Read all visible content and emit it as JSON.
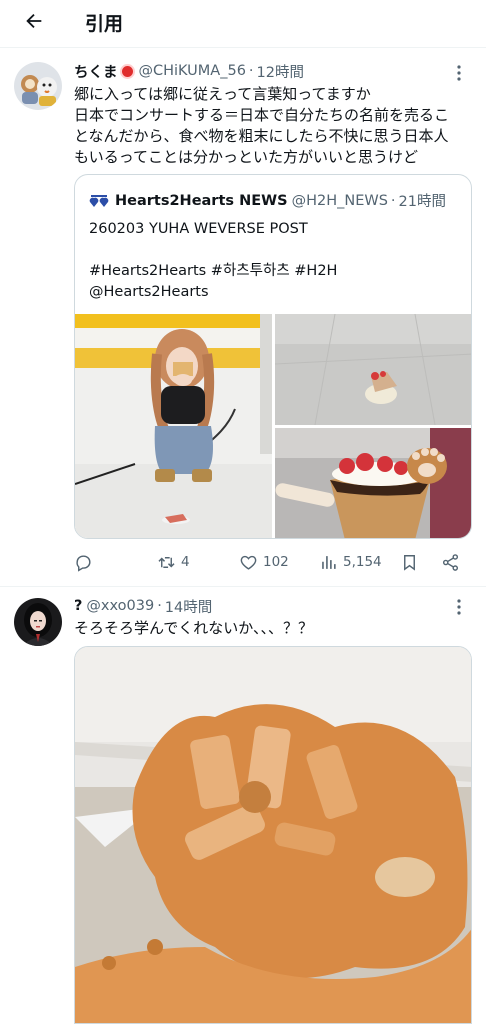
{
  "header": {
    "title": "引用"
  },
  "tweets": [
    {
      "display_name": "ちくま",
      "handle": "@CHiKUMA_56",
      "time": "12時間",
      "text_lines": [
        "郷に入っては郷に従えって言葉知ってますか",
        "日本でコンサートする＝日本で自分たちの名前を売るこ",
        "となんだから、食べ物を粗末にしたら不快に思う日本人",
        "もいるってことは分かっといた方がいいと思うけど"
      ],
      "quote": {
        "display_name": "Hearts2Hearts NEWS",
        "handle": "@H2H_NEWS",
        "time": "21時間",
        "text_lines": [
          "260203 YUHA WEVERSE POST",
          "",
          "#Hearts2Hearts #하츠투하츠 #H2H",
          "@Hearts2Hearts"
        ]
      },
      "actions": {
        "replies": "",
        "retweets": "4",
        "likes": "102",
        "views": "5,154"
      }
    },
    {
      "display_name": "?",
      "handle": "@xxo039",
      "time": "14時間",
      "text_lines": [
        "そろそろ学んでくれないか、、、？？"
      ]
    }
  ],
  "colors": {
    "text": "#0f1419",
    "secondary": "#536471",
    "border": "#cfd9de",
    "divider": "#eff3f4"
  }
}
